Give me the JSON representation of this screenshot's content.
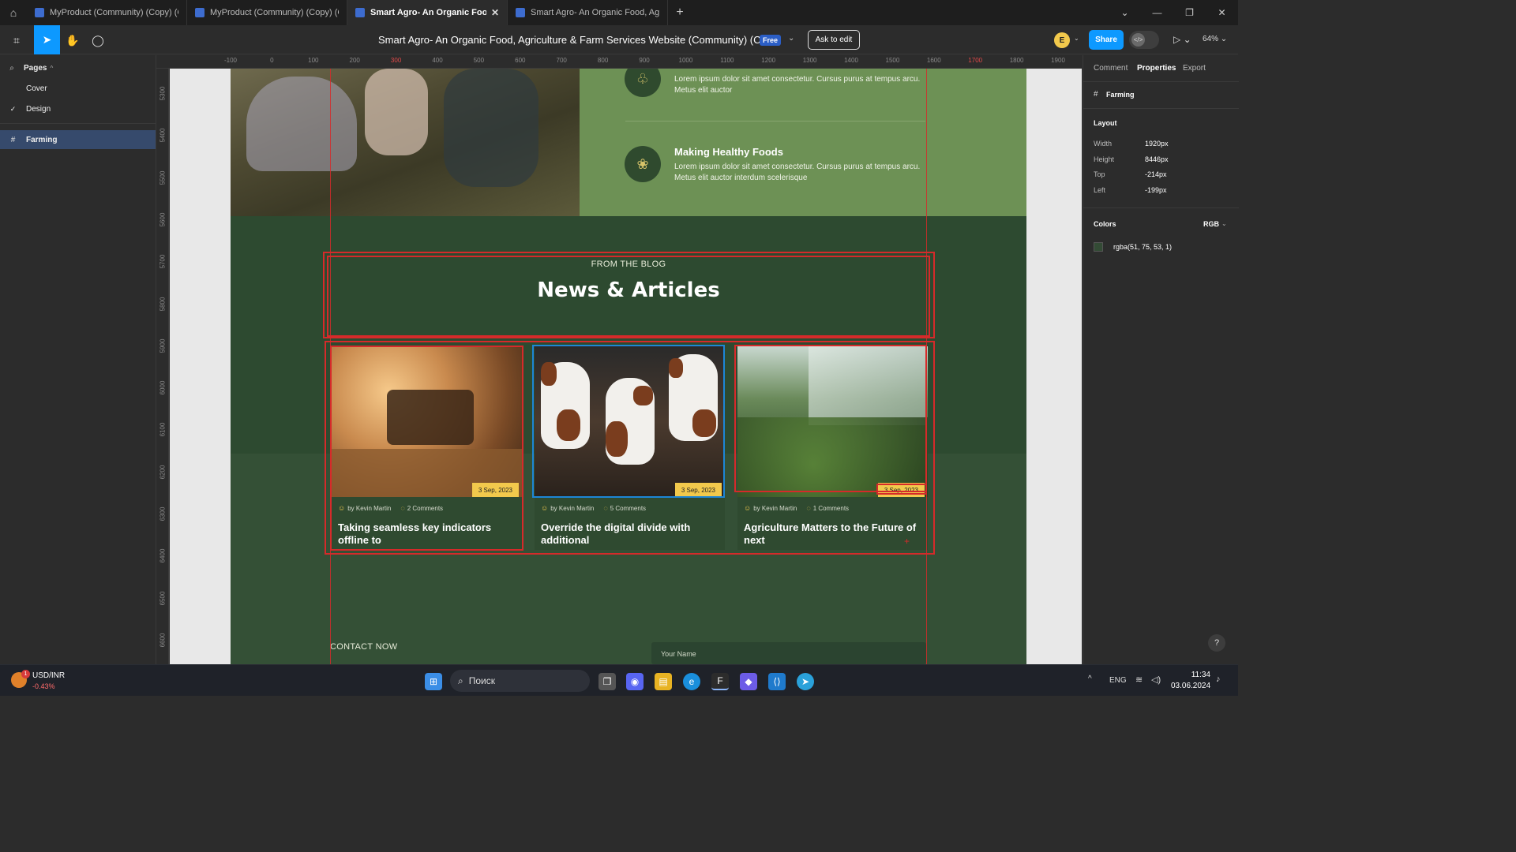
{
  "browser": {
    "tabs": [
      {
        "label": "MyProduct (Community) (Copy) (Cop",
        "active": false
      },
      {
        "label": "MyProduct (Community) (Copy) (Cop",
        "active": false
      },
      {
        "label": "Smart Agro- An Organic Food, Agr",
        "active": true
      },
      {
        "label": "Smart Agro- An Organic Food, Agricu",
        "active": false
      }
    ],
    "new_tab": "+",
    "close_tab": "✕"
  },
  "toolbar": {
    "doc_title": "Smart Agro- An Organic Food, Agriculture & Farm Services Website (Community) (Copy)",
    "plan_badge": "Free",
    "ask_to_edit": "Ask to edit",
    "avatar_letter": "E",
    "share": "Share",
    "zoom": "64%"
  },
  "left_panel": {
    "pages_label": "Pages",
    "pages": [
      {
        "label": "Cover",
        "current": false
      },
      {
        "label": "Design",
        "current": true
      }
    ],
    "layers": [
      {
        "label": "Farming",
        "selected": true
      }
    ]
  },
  "rulers": {
    "top": [
      "-100",
      "0",
      "100",
      "200",
      "300",
      "400",
      "500",
      "600",
      "700",
      "800",
      "900",
      "1000",
      "1100",
      "1200",
      "1300",
      "1400",
      "1500",
      "1600",
      "1700",
      "1800",
      "1900",
      "2000"
    ],
    "top_highlight": [
      "300",
      "1700"
    ],
    "left": [
      "5300",
      "5400",
      "5500",
      "5600",
      "5700",
      "5800",
      "5900",
      "6000",
      "6100",
      "6200",
      "6300",
      "6400",
      "6500",
      "6600"
    ]
  },
  "design": {
    "services": [
      {
        "title": "",
        "desc": "Lorem ipsum dolor sit amet consectetur. Cursus purus at tempus arcu. Metus elit auctor",
        "icon": "growth-chart-icon"
      },
      {
        "title": "Making Healthy Foods",
        "desc": "Lorem ipsum dolor sit amet consectetur. Cursus purus at tempus arcu. Metus elit auctor interdum scelerisque",
        "icon": "healthy-food-icon"
      }
    ],
    "section_tag": "FROM THE BLOG",
    "section_title": "News & Articles",
    "cards": [
      {
        "date": "3 Sep, 2023",
        "author": "by Kevin Martin",
        "comments": "2 Comments",
        "title": "Taking seamless key indicators offline to"
      },
      {
        "date": "3 Sep, 2023",
        "author": "by Kevin Martin",
        "comments": "5 Comments",
        "title": "Override the digital divide with additional"
      },
      {
        "date": "3 Sep, 2023",
        "author": "by Kevin Martin",
        "comments": "1 Comments",
        "title": "Agriculture Matters to the Future of next"
      }
    ],
    "contact_label": "CONTACT NOW",
    "name_placeholder": "Your Name"
  },
  "right_panel": {
    "tabs": [
      "Comment",
      "Properties",
      "Export"
    ],
    "active_tab": "Properties",
    "frame_name": "Farming",
    "layout_heading": "Layout",
    "layout": [
      {
        "label": "Width",
        "value": "1920px"
      },
      {
        "label": "Height",
        "value": "8446px"
      },
      {
        "label": "Top",
        "value": "-214px"
      },
      {
        "label": "Left",
        "value": "-199px"
      }
    ],
    "colors_heading": "Colors",
    "color_mode": "RGB",
    "color_value": "rgba(51, 75, 53, 1)",
    "color_hex": "#334b35"
  },
  "taskbar": {
    "ticker_name": "USD/INR",
    "ticker_change": "-0.43%",
    "ticker_badge": "1",
    "search_placeholder": "Поиск",
    "language": "ENG",
    "time": "11:34",
    "date": "03.06.2024"
  },
  "colors": {
    "accent": "#0d99ff",
    "frame_bg": "#2d4a30",
    "services_bg": "#6d9155",
    "date_badge": "#f2c94c",
    "selection_red": "#d62a2a",
    "selection_blue": "#1d86d6"
  }
}
